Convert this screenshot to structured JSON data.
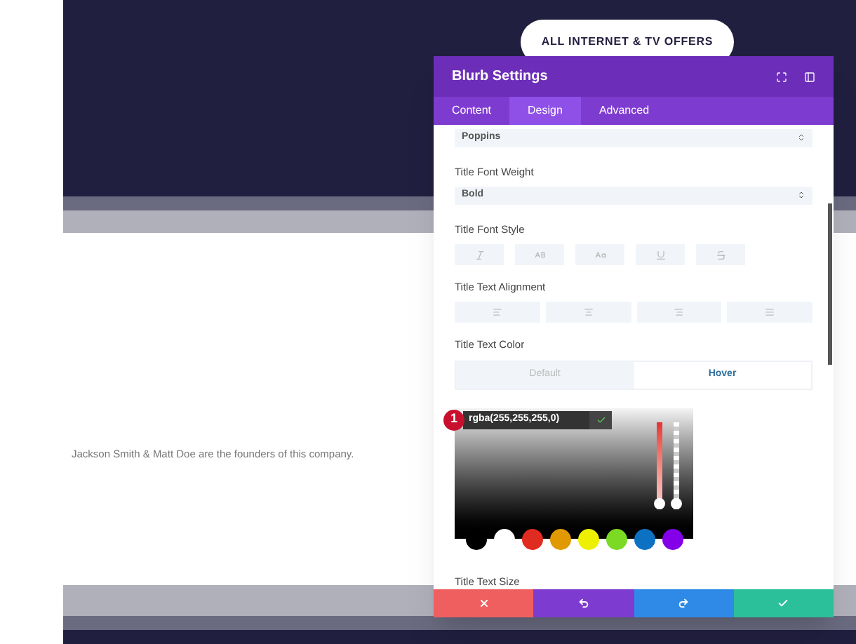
{
  "hero": {
    "offers_button": "ALL INTERNET & TV OFFERS"
  },
  "content": {
    "body_text": "Jackson Smith & Matt Doe are the founders of this company."
  },
  "modal": {
    "title": "Blurb Settings",
    "tabs": [
      {
        "label": "Content",
        "selected": false
      },
      {
        "label": "Design",
        "selected": true
      },
      {
        "label": "Advanced",
        "selected": false
      }
    ],
    "font_select": {
      "value": "Poppins"
    },
    "font_weight": {
      "label": "Title Font Weight",
      "value": "Bold"
    },
    "font_style": {
      "label": "Title Font Style"
    },
    "alignment": {
      "label": "Title Text Alignment"
    },
    "text_color": {
      "label": "Title Text Color",
      "modes": [
        {
          "label": "Default",
          "selected": false
        },
        {
          "label": "Hover",
          "selected": true
        }
      ],
      "badge": "1",
      "value": "rgba(255,255,255,0)",
      "hue": {
        "level": 0
      },
      "alpha": {
        "level": 0
      },
      "swatches": [
        {
          "color": "#000000"
        },
        {
          "color": "#ffffff"
        },
        {
          "color": "#e02b20"
        },
        {
          "color": "#e09900"
        },
        {
          "color": "#edf000"
        },
        {
          "color": "#7cda24"
        },
        {
          "color": "#0c71c3"
        },
        {
          "color": "#8300e9"
        }
      ]
    },
    "size": {
      "label": "Title Text Size"
    }
  }
}
